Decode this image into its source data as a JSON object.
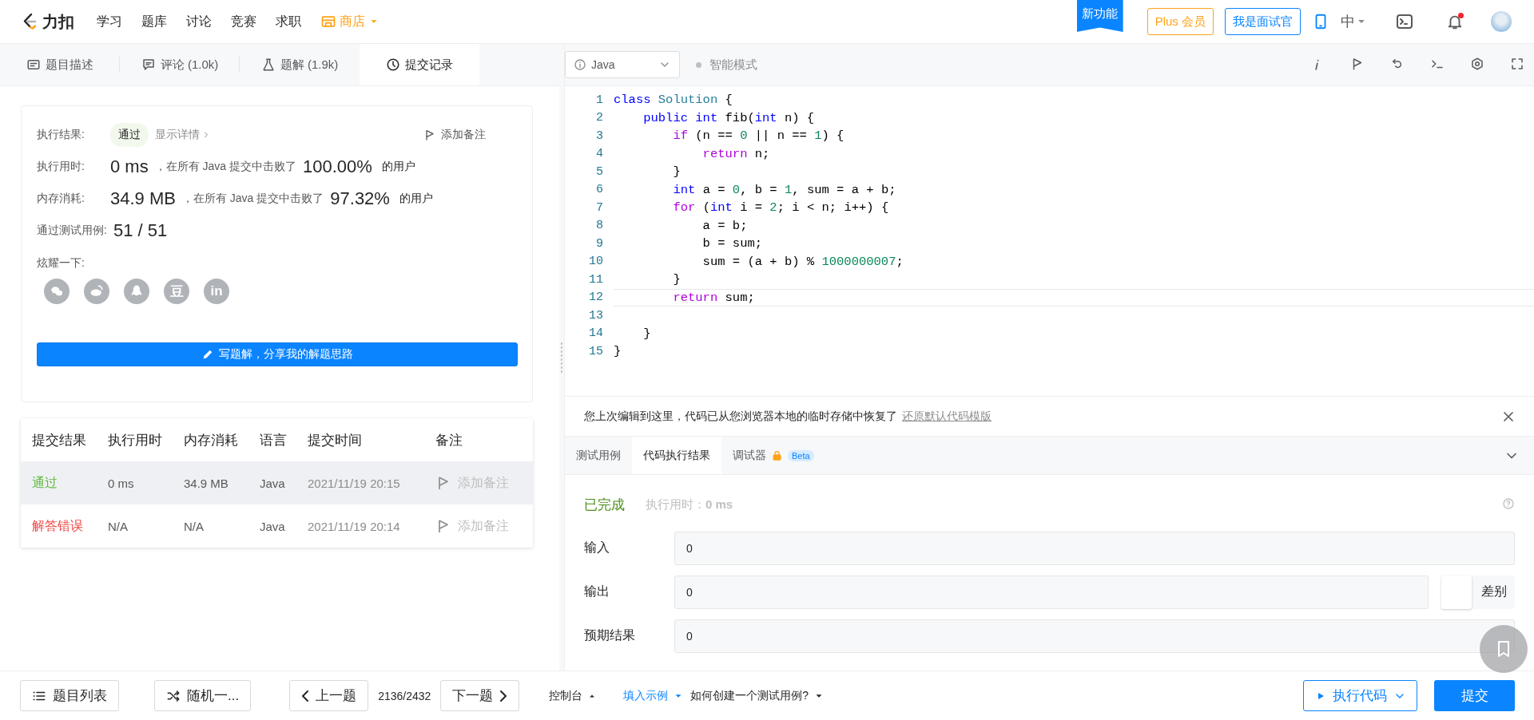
{
  "nav": {
    "logo": "力扣",
    "items": [
      {
        "label": "学习"
      },
      {
        "label": "题库"
      },
      {
        "label": "讨论"
      },
      {
        "label": "竞赛"
      },
      {
        "label": "求职"
      }
    ],
    "store": "商店",
    "new_feature": "新功能",
    "plus": "Plus 会员",
    "interviewer": "我是面试官",
    "language": "中",
    "bell_unread": true
  },
  "problem_tabs": [
    {
      "label": "题目描述",
      "kind": "doc",
      "selected": false
    },
    {
      "label": "评论 (1.0k)",
      "kind": "comment",
      "selected": false
    },
    {
      "label": "题解 (1.9k)",
      "kind": "flask",
      "selected": false
    },
    {
      "label": "提交记录",
      "kind": "clock",
      "selected": true
    }
  ],
  "result_card": {
    "result_label": "执行结果:",
    "result": "通过",
    "details": "显示详情",
    "add_note": "添加备注",
    "stats": [
      {
        "label": "执行用时:",
        "value": "0 ms",
        "text": "，在所有 Java 提交中击败了",
        "percent": "100.00%",
        "suffix": "的用户"
      },
      {
        "label": "内存消耗:",
        "value": "34.9 MB",
        "text": "，在所有 Java 提交中击败了",
        "percent": "97.32%",
        "suffix": "的用户"
      },
      {
        "label": "通过测试用例:",
        "value": "51 / 51"
      }
    ],
    "share_label": "炫耀一下:",
    "share_buttons": [
      {
        "kind": "chat"
      },
      {
        "kind": "eye"
      },
      {
        "kind": "penguin"
      },
      {
        "kind": "text",
        "label": "豆"
      },
      {
        "kind": "text",
        "label": "in"
      }
    ],
    "write_button": "写题解，分享我的解题思路"
  },
  "submissions": {
    "columns": [
      "提交结果",
      "执行用时",
      "内存消耗",
      "语言",
      "提交时间",
      "备注"
    ],
    "rows": [
      {
        "status": "通过",
        "color": "#5fb83b",
        "time": "0 ms",
        "memory": "34.9 MB",
        "language": "Java",
        "submitted": "2021/11/19 20:15",
        "note": "添加备注",
        "selected": true
      },
      {
        "status": "解答错误",
        "color": "#ef4743",
        "time": "N/A",
        "memory": "N/A",
        "language": "Java",
        "submitted": "2021/11/19 20:14",
        "note": "添加备注",
        "selected": false
      }
    ]
  },
  "editor": {
    "language": "Java",
    "smart_mode": {
      "label": "智能模式",
      "on": false
    },
    "lines": [
      {
        "number": "1",
        "current": false,
        "tokens": [
          {
            "text": "class ",
            "kind": "type"
          },
          {
            "text": "Solution",
            "kind": "class"
          },
          {
            "text": " {",
            "kind": "plain"
          }
        ]
      },
      {
        "number": "2",
        "current": false,
        "tokens": [
          {
            "text": "    public int",
            "kind": "type"
          },
          {
            "text": " fib(",
            "kind": "plain"
          },
          {
            "text": "int",
            "kind": "type"
          },
          {
            "text": " n) {",
            "kind": "plain"
          }
        ]
      },
      {
        "number": "3",
        "current": false,
        "tokens": [
          {
            "text": "        if",
            "kind": "keyword"
          },
          {
            "text": " (n == ",
            "kind": "plain"
          },
          {
            "text": "0",
            "kind": "number"
          },
          {
            "text": " || n == ",
            "kind": "plain"
          },
          {
            "text": "1",
            "kind": "number"
          },
          {
            "text": ") {",
            "kind": "plain"
          }
        ]
      },
      {
        "number": "4",
        "current": false,
        "tokens": [
          {
            "text": "            return",
            "kind": "keyword"
          },
          {
            "text": " n;",
            "kind": "plain"
          }
        ]
      },
      {
        "number": "5",
        "current": false,
        "tokens": [
          {
            "text": "        }",
            "kind": "plain"
          }
        ]
      },
      {
        "number": "6",
        "current": false,
        "tokens": [
          {
            "text": "        int",
            "kind": "type"
          },
          {
            "text": " a = ",
            "kind": "plain"
          },
          {
            "text": "0",
            "kind": "number"
          },
          {
            "text": ", b = ",
            "kind": "plain"
          },
          {
            "text": "1",
            "kind": "number"
          },
          {
            "text": ", sum = a + b;",
            "kind": "plain"
          }
        ]
      },
      {
        "number": "7",
        "current": false,
        "tokens": [
          {
            "text": "        for",
            "kind": "keyword"
          },
          {
            "text": " (",
            "kind": "plain"
          },
          {
            "text": "int",
            "kind": "type"
          },
          {
            "text": " i = ",
            "kind": "plain"
          },
          {
            "text": "2",
            "kind": "number"
          },
          {
            "text": "; i < n; i++) {",
            "kind": "plain"
          }
        ]
      },
      {
        "number": "8",
        "current": false,
        "tokens": [
          {
            "text": "            a = b;",
            "kind": "plain"
          }
        ]
      },
      {
        "number": "9",
        "current": false,
        "tokens": [
          {
            "text": "            b = sum;",
            "kind": "plain"
          }
        ]
      },
      {
        "number": "10",
        "current": false,
        "tokens": [
          {
            "text": "            sum = (a + b) % ",
            "kind": "plain"
          },
          {
            "text": "1000000007",
            "kind": "number"
          },
          {
            "text": ";",
            "kind": "plain"
          }
        ]
      },
      {
        "number": "11",
        "current": false,
        "tokens": [
          {
            "text": "        }",
            "kind": "plain"
          }
        ]
      },
      {
        "number": "12",
        "current": true,
        "tokens": [
          {
            "text": "        return",
            "kind": "keyword"
          },
          {
            "text": " sum;",
            "kind": "plain"
          }
        ]
      },
      {
        "number": "13",
        "current": false
      },
      {
        "number": "14",
        "current": false,
        "tokens": [
          {
            "text": "    }",
            "kind": "plain"
          }
        ]
      },
      {
        "number": "15",
        "current": false,
        "tokens": [
          {
            "text": "}",
            "kind": "plain"
          }
        ]
      }
    ]
  },
  "notice": {
    "text": "您上次编辑到这里，代码已从您浏览器本地的临时存储中恢复了",
    "link": "还原默认代码模版"
  },
  "console_tabs": [
    {
      "label": "测试用例",
      "selected": false
    },
    {
      "label": "代码执行结果",
      "selected": true
    },
    {
      "label": "调试器",
      "selected": false,
      "locked": true,
      "badge": "Beta"
    }
  ],
  "run_result": {
    "status": "已完成",
    "time": "执行用时：**0 ms**",
    "fields": [
      {
        "label": "输入",
        "value": "0"
      },
      {
        "label": "输出",
        "value": "0"
      },
      {
        "label": "预期结果",
        "value": "0"
      }
    ],
    "diff": {
      "label": "差别",
      "checked": false
    }
  },
  "footer": {
    "problem_list": "题目列表",
    "random": "随机一...",
    "prev": "上一题",
    "progress": "2136/2432",
    "next": "下一题",
    "console": "控制台",
    "fill_example": "填入示例",
    "how_to": "如何创建一个测试用例?",
    "run": "执行代码",
    "submit": "提交"
  }
}
